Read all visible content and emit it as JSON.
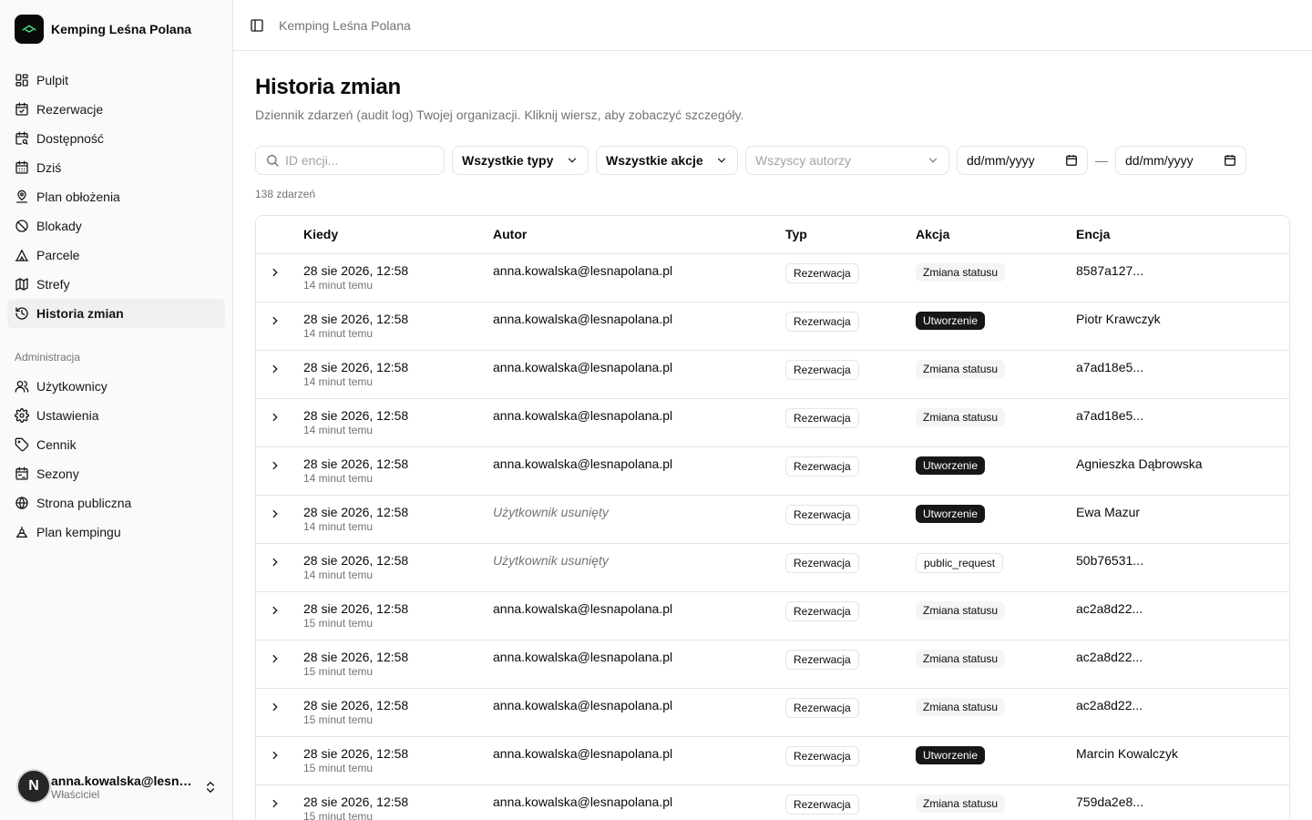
{
  "app": {
    "name": "Kemping Leśna Polana",
    "logo_icon": "camping-tent-icon",
    "accent": "#0a0a0a"
  },
  "sidebar": {
    "items": [
      {
        "label": "Pulpit",
        "icon": "dashboard-icon"
      },
      {
        "label": "Rezerwacje",
        "icon": "calendar-check-icon"
      },
      {
        "label": "Dostępność",
        "icon": "calendar-search-icon"
      },
      {
        "label": "Dziś",
        "icon": "calendar-icon"
      },
      {
        "label": "Plan obłożenia",
        "icon": "map-pin-icon"
      },
      {
        "label": "Blokady",
        "icon": "ban-icon"
      },
      {
        "label": "Parcele",
        "icon": "tent-icon"
      },
      {
        "label": "Strefy",
        "icon": "map-icon"
      },
      {
        "label": "Historia zmian",
        "icon": "history-icon",
        "active": true
      }
    ],
    "admin_label": "Administracja",
    "admin_items": [
      {
        "label": "Użytkownicy",
        "icon": "users-icon"
      },
      {
        "label": "Ustawienia",
        "icon": "gear-icon"
      },
      {
        "label": "Cennik",
        "icon": "tag-icon"
      },
      {
        "label": "Sezony",
        "icon": "calendar-range-icon"
      },
      {
        "label": "Strona publiczna",
        "icon": "globe-icon"
      },
      {
        "label": "Plan kempingu",
        "icon": "layout-icon"
      }
    ],
    "user": {
      "initial": "N",
      "email": "anna.kowalska@lesnapolana.pl",
      "role": "Właściciel"
    }
  },
  "topbar": {
    "breadcrumb": "Kemping Leśna Polana"
  },
  "page": {
    "title": "Historia zmian",
    "subtitle": "Dziennik zdarzeń (audit log) Twojej organizacji. Kliknij wiersz, aby zobaczyć szczegóły."
  },
  "filters": {
    "search_placeholder": "ID encji...",
    "type_select": "Wszystkie typy",
    "action_select": "Wszystkie akcje",
    "author_select": "Wszyscy autorzy",
    "date_from": "dd/mm/yyyy",
    "date_to": "dd/mm/yyyy",
    "date_separator": "—"
  },
  "count_label": "138 zdarzeń",
  "table": {
    "headers": [
      "Kiedy",
      "Autor",
      "Typ",
      "Akcja",
      "Encja"
    ],
    "rows": [
      {
        "when": "28 sie 2026, 12:58",
        "rel": "14 minut temu",
        "author": "anna.kowalska@lesnapolana.pl",
        "deleted": false,
        "type": "Rezerwacja",
        "action": "Zmiana statusu",
        "action_style": "muted",
        "entity": "8587a127..."
      },
      {
        "when": "28 sie 2026, 12:58",
        "rel": "14 minut temu",
        "author": "anna.kowalska@lesnapolana.pl",
        "deleted": false,
        "type": "Rezerwacja",
        "action": "Utworzenie",
        "action_style": "dark",
        "entity": "Piotr Krawczyk"
      },
      {
        "when": "28 sie 2026, 12:58",
        "rel": "14 minut temu",
        "author": "anna.kowalska@lesnapolana.pl",
        "deleted": false,
        "type": "Rezerwacja",
        "action": "Zmiana statusu",
        "action_style": "muted",
        "entity": "a7ad18e5..."
      },
      {
        "when": "28 sie 2026, 12:58",
        "rel": "14 minut temu",
        "author": "anna.kowalska@lesnapolana.pl",
        "deleted": false,
        "type": "Rezerwacja",
        "action": "Zmiana statusu",
        "action_style": "muted",
        "entity": "a7ad18e5..."
      },
      {
        "when": "28 sie 2026, 12:58",
        "rel": "14 minut temu",
        "author": "anna.kowalska@lesnapolana.pl",
        "deleted": false,
        "type": "Rezerwacja",
        "action": "Utworzenie",
        "action_style": "dark",
        "entity": "Agnieszka Dąbrowska"
      },
      {
        "when": "28 sie 2026, 12:58",
        "rel": "14 minut temu",
        "author": "Użytkownik usunięty",
        "deleted": true,
        "type": "Rezerwacja",
        "action": "Utworzenie",
        "action_style": "dark",
        "entity": "Ewa Mazur"
      },
      {
        "when": "28 sie 2026, 12:58",
        "rel": "14 minut temu",
        "author": "Użytkownik usunięty",
        "deleted": true,
        "type": "Rezerwacja",
        "action": "public_request",
        "action_style": "outline",
        "entity": "50b76531..."
      },
      {
        "when": "28 sie 2026, 12:58",
        "rel": "15 minut temu",
        "author": "anna.kowalska@lesnapolana.pl",
        "deleted": false,
        "type": "Rezerwacja",
        "action": "Zmiana statusu",
        "action_style": "muted",
        "entity": "ac2a8d22..."
      },
      {
        "when": "28 sie 2026, 12:58",
        "rel": "15 minut temu",
        "author": "anna.kowalska@lesnapolana.pl",
        "deleted": false,
        "type": "Rezerwacja",
        "action": "Zmiana statusu",
        "action_style": "muted",
        "entity": "ac2a8d22..."
      },
      {
        "when": "28 sie 2026, 12:58",
        "rel": "15 minut temu",
        "author": "anna.kowalska@lesnapolana.pl",
        "deleted": false,
        "type": "Rezerwacja",
        "action": "Zmiana statusu",
        "action_style": "muted",
        "entity": "ac2a8d22..."
      },
      {
        "when": "28 sie 2026, 12:58",
        "rel": "15 minut temu",
        "author": "anna.kowalska@lesnapolana.pl",
        "deleted": false,
        "type": "Rezerwacja",
        "action": "Utworzenie",
        "action_style": "dark",
        "entity": "Marcin Kowalczyk"
      },
      {
        "when": "28 sie 2026, 12:58",
        "rel": "15 minut temu",
        "author": "anna.kowalska@lesnapolana.pl",
        "deleted": false,
        "type": "Rezerwacja",
        "action": "Zmiana statusu",
        "action_style": "muted",
        "entity": "759da2e8..."
      }
    ]
  }
}
